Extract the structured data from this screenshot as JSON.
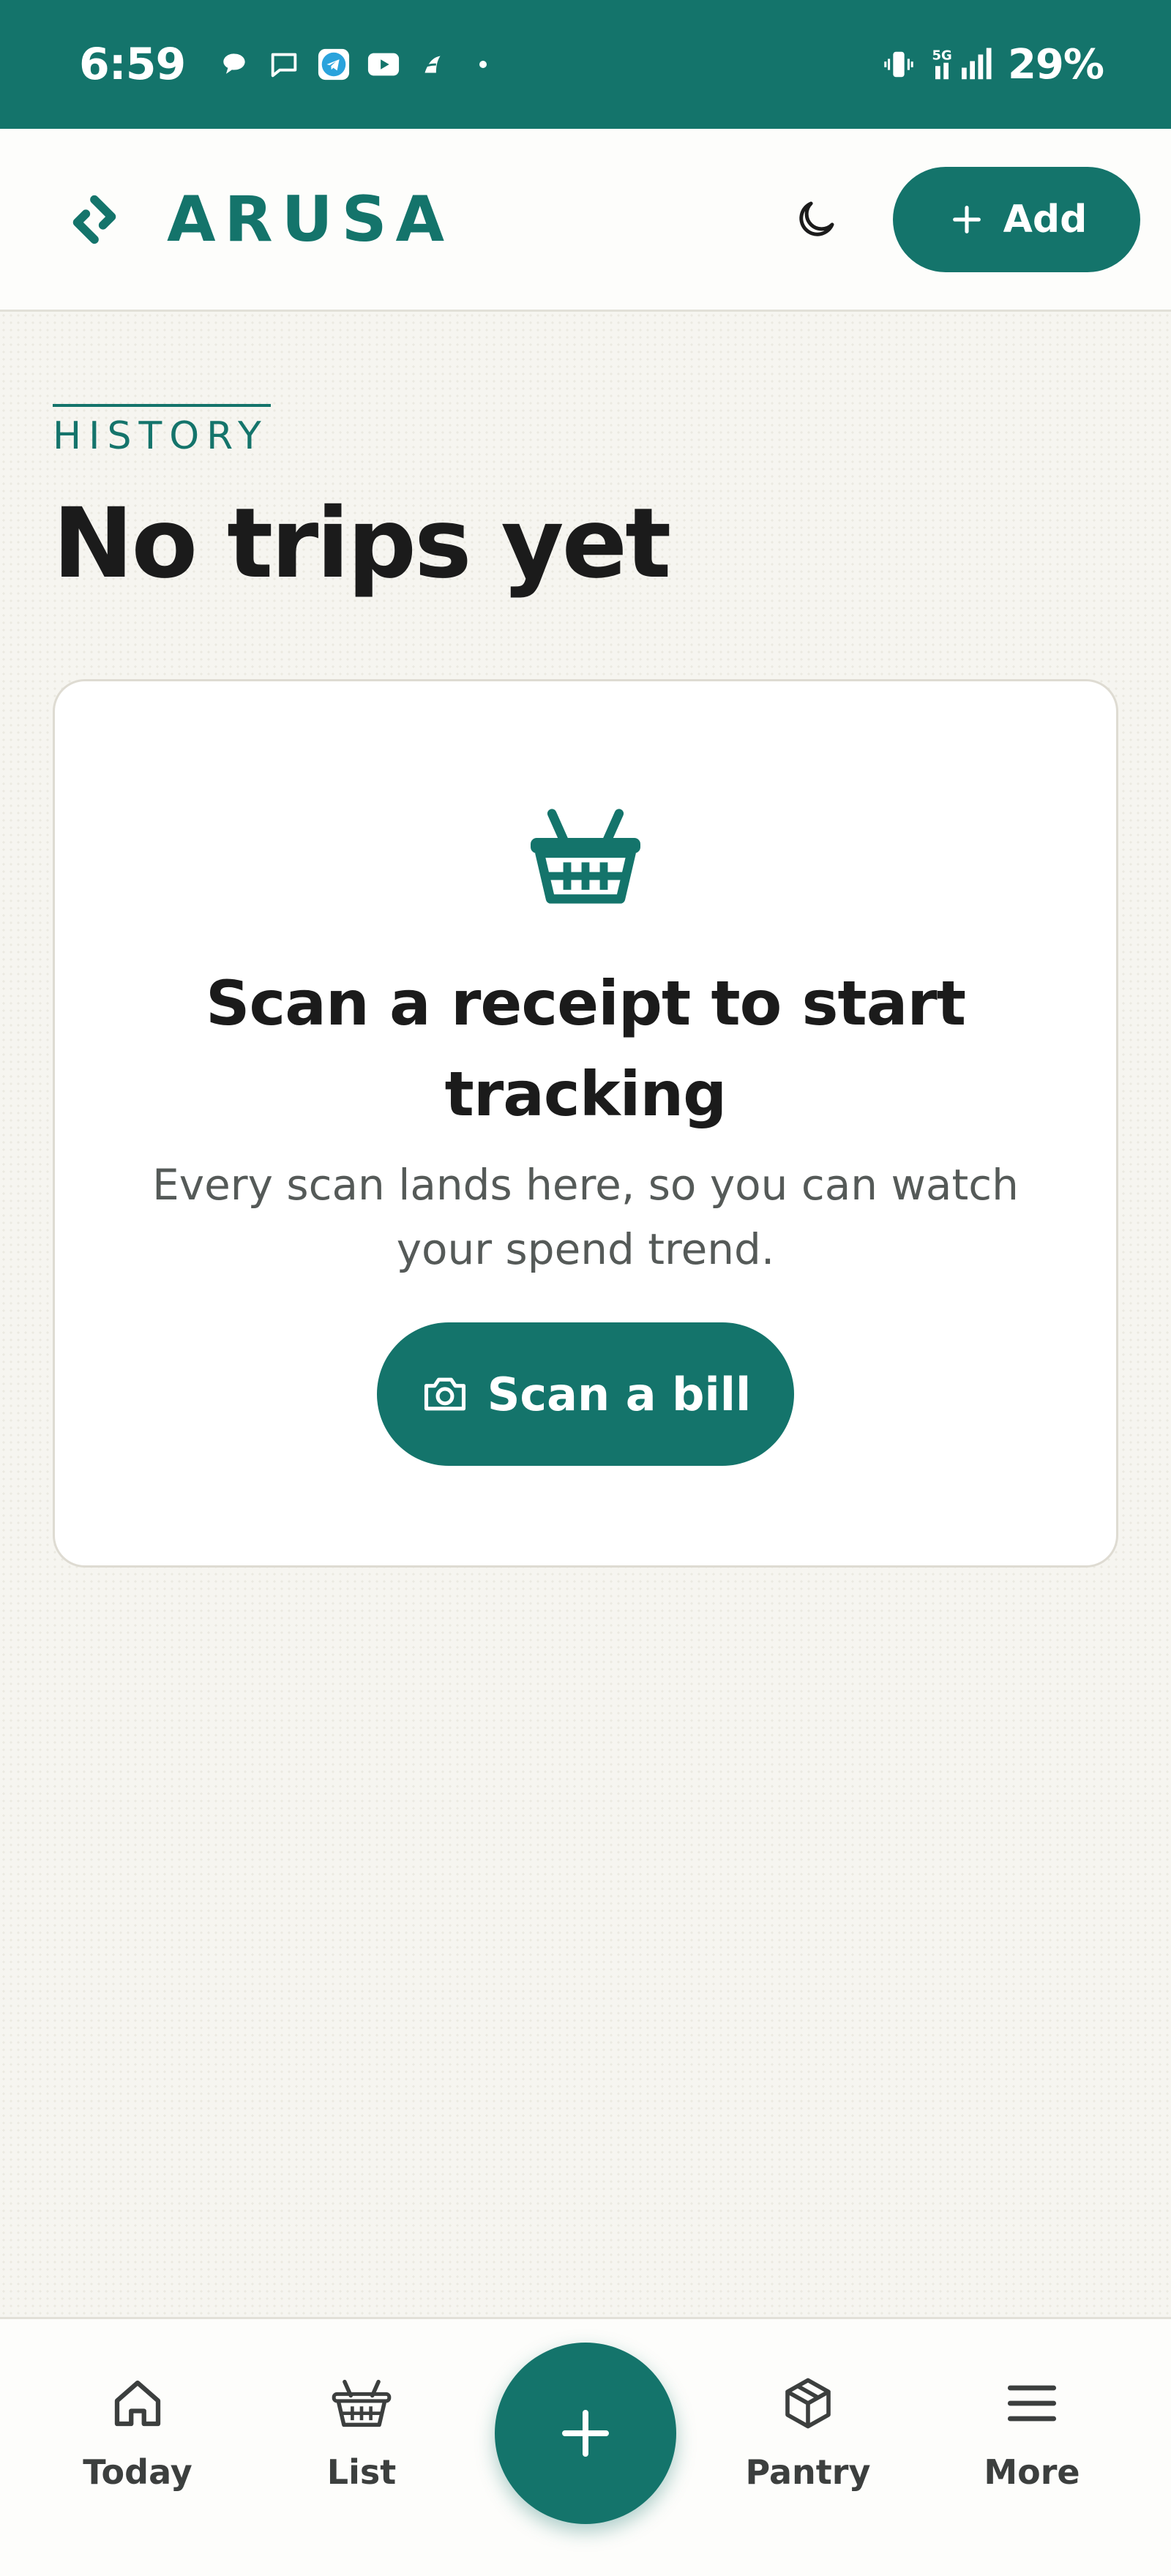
{
  "status_bar": {
    "time": "6:59",
    "battery": "29%",
    "notification_icons": [
      "chat-bubble-icon",
      "message-icon",
      "telegram-icon",
      "youtube-icon",
      "app-icon",
      "dot-icon"
    ],
    "system_icons": [
      "vibrate-icon",
      "5g-signal-icon"
    ],
    "background": "#14746b"
  },
  "header": {
    "brand_name": "ARUSA",
    "theme_toggle_icon": "moon-icon",
    "add_label": "Add"
  },
  "page": {
    "eyebrow": "HISTORY",
    "title": "No trips yet"
  },
  "empty_state": {
    "icon": "basket-icon",
    "title": "Scan a receipt to start tracking",
    "description": "Every scan lands here, so you can watch your spend trend.",
    "button_label": "Scan a bill",
    "button_icon": "camera-icon"
  },
  "bottom_nav": {
    "items": [
      {
        "label": "Today",
        "icon": "home-icon"
      },
      {
        "label": "List",
        "icon": "basket-icon"
      },
      {
        "label": "Pantry",
        "icon": "box-icon"
      },
      {
        "label": "More",
        "icon": "menu-icon"
      }
    ],
    "fab_icon": "plus-icon"
  },
  "colors": {
    "accent": "#14746b",
    "background": "#f6f5f0",
    "card": "#ffffff",
    "text": "#1b1b1b"
  }
}
